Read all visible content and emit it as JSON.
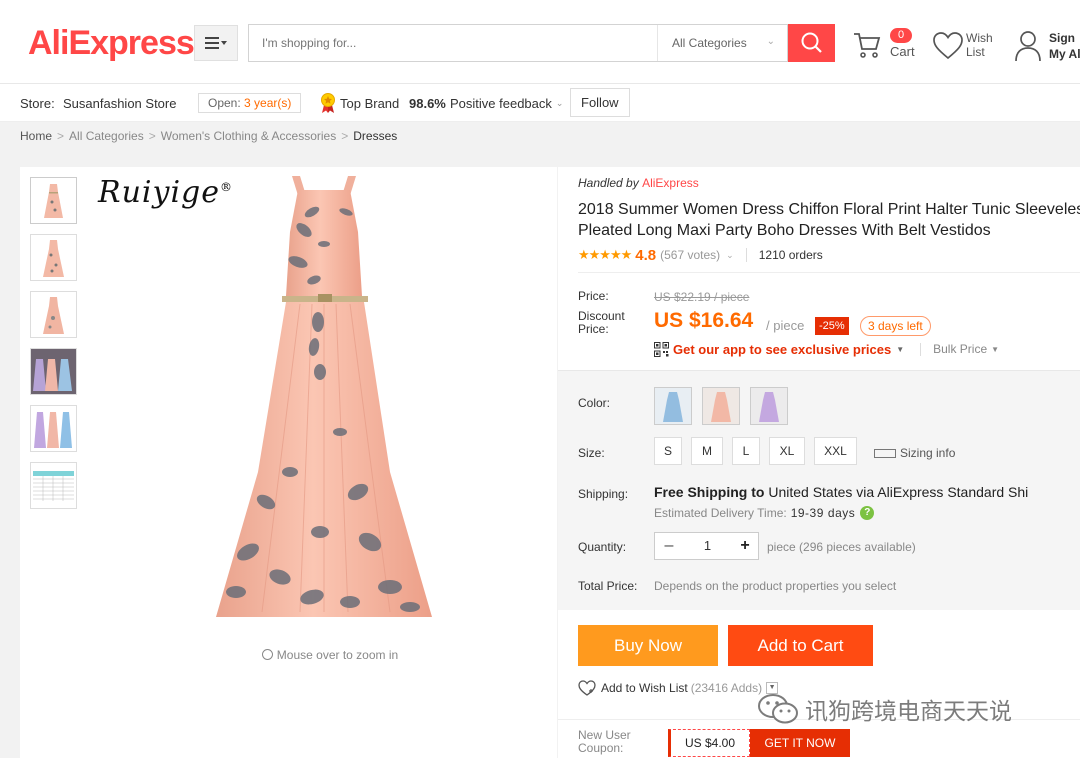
{
  "header": {
    "logo_ali": "Ali",
    "logo_express": "Express",
    "logo_tm": "™",
    "search_placeholder": "I'm shopping for...",
    "category": "All Categories",
    "cart_count": "0",
    "cart_label": "Cart",
    "wish_label_1": "Wish",
    "wish_label_2": "List",
    "sign_label_1": "Sign",
    "sign_label_2": "My Al",
    "accent": "#ff4747"
  },
  "store": {
    "label": "Store:",
    "name": "Susanfashion Store",
    "open_prefix": "Open:",
    "open_years": "3 year(s)",
    "top_brand": "Top Brand",
    "feedback_pct": "98.6%",
    "feedback_label": "Positive feedback",
    "follow": "Follow"
  },
  "breadcrumb": {
    "items": [
      "Home",
      "All Categories",
      "Women's Clothing & Accessories",
      "Dresses"
    ],
    "separator": ">"
  },
  "gallery": {
    "brand": "Ruiyige",
    "brand_mark": "®",
    "zoom_hint": "Mouse over to zoom in"
  },
  "product": {
    "handled_by": "Handled by",
    "handler": "AliExpress",
    "title_line1": "2018 Summer Women Dress Chiffon Floral Print Halter Tunic Sleeveles",
    "title_line2": "Pleated Long Maxi Party Boho Dresses With Belt Vestidos",
    "stars": "★★★★★",
    "rating": "4.8",
    "votes": "(567 votes)",
    "orders": "1210 orders"
  },
  "price": {
    "label": "Price:",
    "original": "US $22.19 / piece",
    "discount_label": "Discount Price:",
    "discount_price": "US $16.64",
    "per_piece": "/ piece",
    "discount_pct": "-25%",
    "days_left": "3 days left",
    "app_promo": "Get our app to see exclusive prices",
    "bulk": "Bulk Price"
  },
  "options": {
    "color_label": "Color:",
    "size_label": "Size:",
    "sizes": [
      "S",
      "M",
      "L",
      "XL",
      "XXL"
    ],
    "sizing_info": "Sizing info",
    "shipping_label": "Shipping:",
    "shipping_free": "Free Shipping to",
    "shipping_rest": "United States via AliExpress Standard Shi",
    "est_label": "Estimated Delivery Time:",
    "est_days": "19-39",
    "est_unit": "days",
    "qty_label": "Quantity:",
    "qty_value": "1",
    "qty_avail": "piece (296 pieces available)",
    "total_label": "Total Price:",
    "total_value": "Depends on the product properties you select"
  },
  "actions": {
    "buy_now": "Buy Now",
    "add_to_cart": "Add to Cart",
    "wishlist": "Add to Wish List",
    "wishlist_count": "(23416 Adds)"
  },
  "coupon": {
    "label": "New User Coupon:",
    "value": "US $4.00",
    "button": "GET IT NOW"
  },
  "watermark": {
    "text": "讯狗跨境电商天天说"
  }
}
